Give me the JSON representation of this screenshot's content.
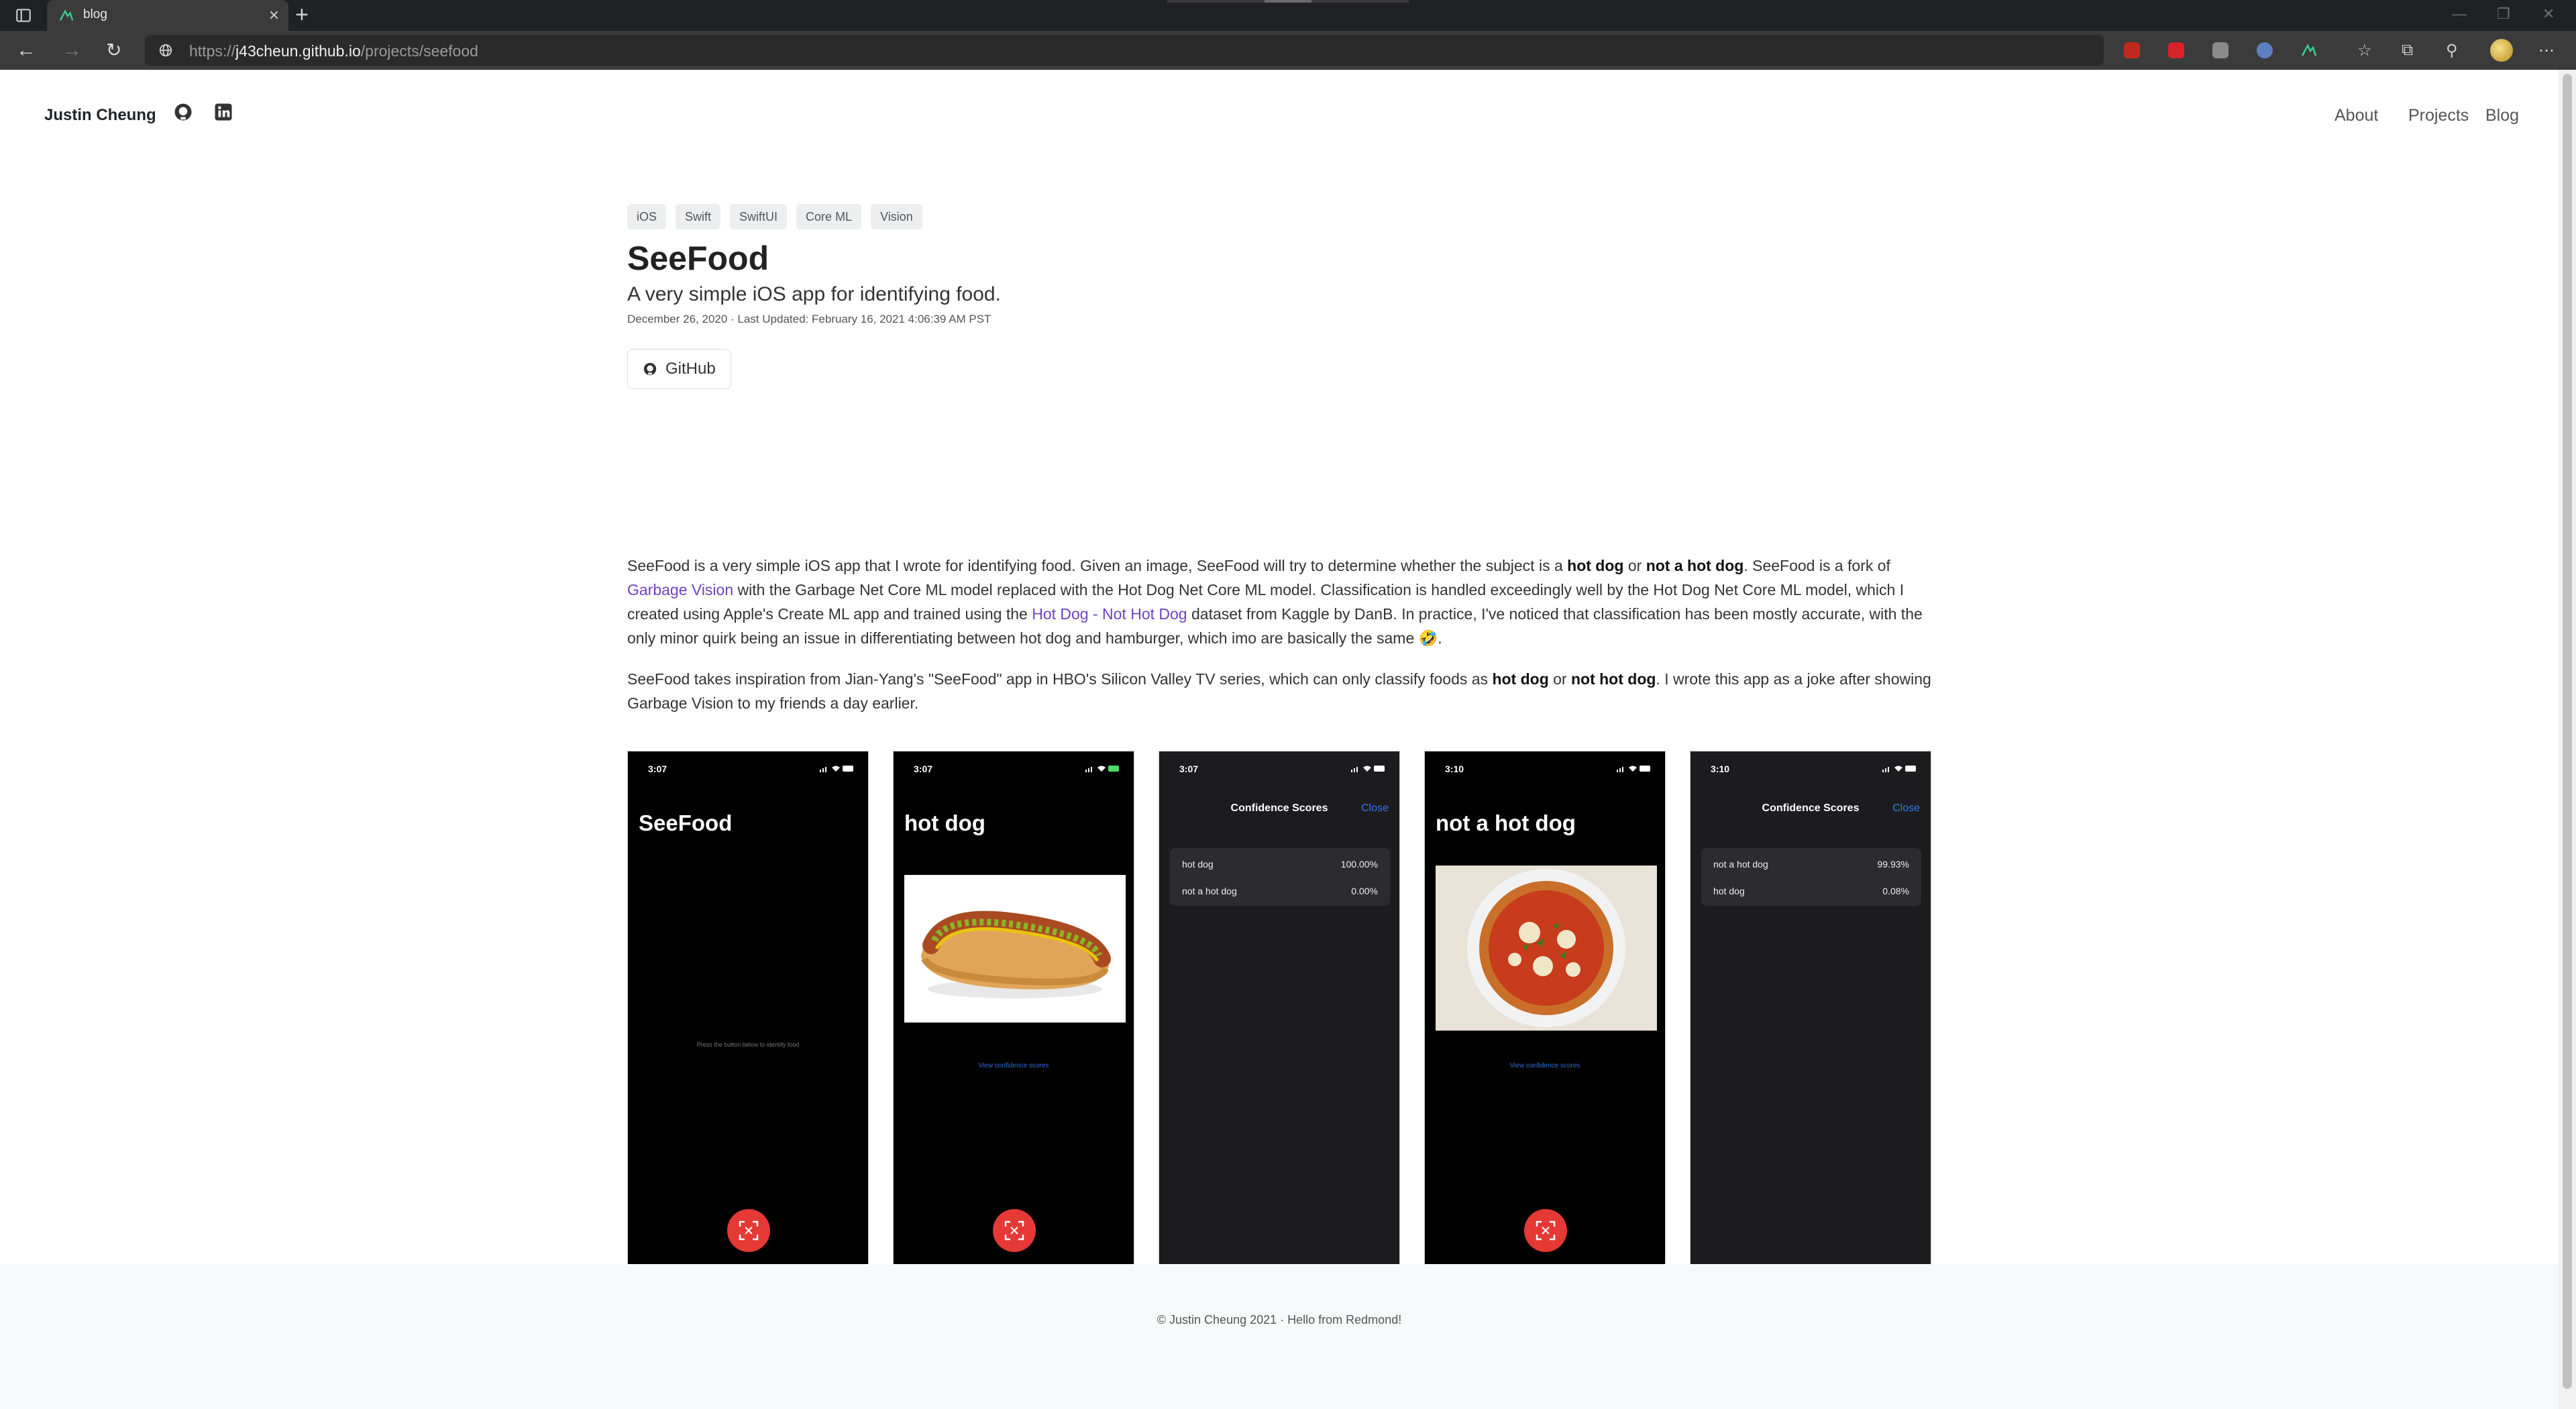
{
  "browser": {
    "tab_title": "blog",
    "url_prefix": "https://",
    "url_host": "j43cheun.github.io",
    "url_path": "/projects/seefood"
  },
  "site_nav": {
    "brand": "Justin Cheung",
    "links": [
      "About",
      "Projects",
      "Blog"
    ]
  },
  "post": {
    "tags": [
      "iOS",
      "Swift",
      "SwiftUI",
      "Core ML",
      "Vision"
    ],
    "title": "SeeFood",
    "subtitle": "A very simple iOS app for identifying food.",
    "dates": "December 26, 2020 · Last Updated: February 16, 2021 4:06:39 AM PST",
    "github_button": "GitHub",
    "p1": {
      "t1": "SeeFood is a very simple iOS app that I wrote for identifying food. Given an image, SeeFood will try to determine whether the subject is a ",
      "b1": "hot dog",
      "t2": " or ",
      "b2": "not a hot dog",
      "t3": ". SeeFood is a fork of ",
      "link1": "Garbage Vision",
      "t4": " with the Garbage Net Core ML model replaced with the Hot Dog Net Core ML model. Classification is handled exceedingly well by the Hot Dog Net Core ML model, which I created using Apple's Create ML app and trained using the ",
      "link2": "Hot Dog - Not Hot Dog",
      "t5": " dataset from Kaggle by DanB. In practice, I've noticed that classification has been mostly accurate, with the only minor quirk being an issue in differentiating between hot dog and hamburger, which imo are basically the same ",
      "emoji": "🤣",
      "t6": "."
    },
    "p2": {
      "t1": "SeeFood takes inspiration from Jian-Yang's \"SeeFood\" app in HBO's Silicon Valley TV series, which can only classify foods as ",
      "b1": "hot dog",
      "t2": " or ",
      "b2": "not hot dog",
      "t3": ". I wrote this app as a joke after showing Garbage Vision to my friends a day earlier."
    }
  },
  "phones": {
    "p1": {
      "time": "3:07",
      "title": "SeeFood",
      "hint": "Press the button below to identify food"
    },
    "p2": {
      "time": "3:07",
      "title": "hot dog",
      "link": "View confidence scores"
    },
    "p3": {
      "time": "3:07",
      "header": "Confidence Scores",
      "close": "Close",
      "rows": [
        {
          "label": "hot dog",
          "value": "100.00%"
        },
        {
          "label": "not a hot dog",
          "value": "0.00%"
        }
      ]
    },
    "p4": {
      "time": "3:10",
      "title": "not a hot dog",
      "link": "View confidence scores"
    },
    "p5": {
      "time": "3:10",
      "header": "Confidence Scores",
      "close": "Close",
      "rows": [
        {
          "label": "not a hot dog",
          "value": "99.93%"
        },
        {
          "label": "hot dog",
          "value": "0.08%"
        }
      ]
    }
  },
  "footer": {
    "text": "© Justin Cheung 2021 · Hello from Redmond!"
  },
  "colors": {
    "link": "#6f42c1",
    "shutter": "#e53935",
    "ios_blue": "#2f7be8"
  }
}
